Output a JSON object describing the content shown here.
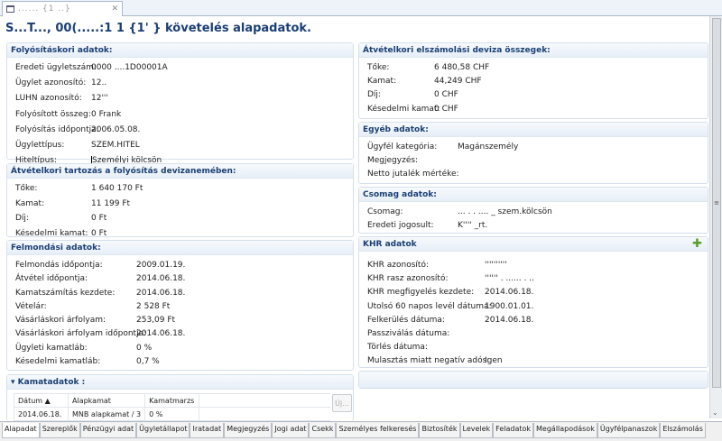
{
  "editor_tab": {
    "label": "......     {1 ..}",
    "close": "✕"
  },
  "title": "S...T..., 00(.....:1   1 {1'   } követelés alapadatok.",
  "folyositas": {
    "header": "Folyósításkori adatok:",
    "rows": [
      {
        "label": "Eredeti ügyletszám:",
        "value": "0000 ....1D00001A"
      },
      {
        "label": "Ügylet azonosító:",
        "value": "12.."
      },
      {
        "label": "LUHN azonosító:",
        "value": "12'''"
      },
      {
        "label": "Folyósított összeg:",
        "value": "0 Frank"
      },
      {
        "label": "Folyósítás időpontja:",
        "value": "2006.05.08."
      },
      {
        "label": "Ügylettípus:",
        "value": "SZEM.HITEL"
      },
      {
        "label": "Hiteltípus:",
        "value": "Személyi kölcsön"
      }
    ]
  },
  "tartozas": {
    "header": "Átvételkori tartozás a folyósítás devizanemében:",
    "rows": [
      {
        "label": "Tőke:",
        "value": "1 640 170 Ft"
      },
      {
        "label": "Kamat:",
        "value": "11 199 Ft"
      },
      {
        "label": "Díj:",
        "value": "0 Ft"
      },
      {
        "label": "Késedelmi kamat:",
        "value": "0 Ft"
      }
    ]
  },
  "felmondas": {
    "header": "Felmondási adatok:",
    "rows": [
      {
        "label": "Felmondás időpontja:",
        "value": "2009.01.19."
      },
      {
        "label": "Átvétel időpontja:",
        "value": " 2014.06.18."
      },
      {
        "label": "Kamatszámítás kezdete:",
        "value": " 2014.06.18."
      },
      {
        "label": "Vételár:",
        "value": "2 528 Ft"
      },
      {
        "label": "Vásárláskori árfolyam:",
        "value": "253,09 Ft"
      },
      {
        "label": "Vásárláskori árfolyam időpontja:",
        "value": "2014.06.18."
      },
      {
        "label": "Ügyleti kamatláb:",
        "value": " 0 %"
      },
      {
        "label": "Késedelmi kamatláb:",
        "value": " 0,7 %"
      }
    ]
  },
  "kamatadatok": {
    "header": "Kamatadatok :",
    "columns": [
      "Dátum",
      "Alapkamat",
      "Kamatmarzs"
    ],
    "rows": [
      [
        "2014.06.18.",
        "MNB alapkamat / 3",
        "0 %"
      ]
    ],
    "new_button": "Új..."
  },
  "deviza": {
    "header": "Átvételkori elszámolási deviza összegek:",
    "rows": [
      {
        "label": "Tőke:",
        "value": "6 480,58 CHF"
      },
      {
        "label": "Kamat:",
        "value": "44,249 CHF"
      },
      {
        "label": "Díj:",
        "value": "0 CHF"
      },
      {
        "label": "Késedelmi kamat:",
        "value": "0 CHF"
      }
    ]
  },
  "egyeb": {
    "header": "Egyéb adatok:",
    "rows": [
      {
        "label": "Ügyfél kategória:",
        "value": "Magánszemély"
      },
      {
        "label": "Megjegyzés:",
        "value": ""
      },
      {
        "label": "Netto jutalék mértéke:",
        "value": ""
      }
    ]
  },
  "csomag": {
    "header": "Csomag adatok:",
    "rows": [
      {
        "label": "Csomag:",
        "value": "... . . .... _ szem.kölcsön"
      },
      {
        "label": "Eredeti jogosult:",
        "value": "K''''     _rt."
      }
    ]
  },
  "khr": {
    "header": "KHR adatok",
    "rows": [
      {
        "label": "KHR azonosító:",
        "value": "''''''''''"
      },
      {
        "label": "KHR rasz azonosító:",
        "value": "''''''  . ...... . .."
      },
      {
        "label": "KHR megfigyelés kezdete:",
        "value": "2014.06.18."
      },
      {
        "label": "Utolsó 60 napos levél dátuma:",
        "value": "1900.01.01."
      },
      {
        "label": "Felkerülés dátuma:",
        "value": "2014.06.18."
      },
      {
        "label": "Passziválás dátuma:",
        "value": ""
      },
      {
        "label": "Törlés dátuma:",
        "value": ""
      },
      {
        "label": "Mulasztás miatt negatív adós:",
        "value": "Igen"
      }
    ]
  },
  "bottom_tabs": [
    "Alapadat",
    "Szereplők",
    "Pénzügyi adat",
    "Ügyletállapot",
    "Iratadat",
    "Megjegyzés",
    "Jogi adat",
    "Csekk",
    "Személyes felkeresés",
    "Biztosíték",
    "Levelek",
    "Feladatok",
    "Megállapodások",
    "Ügyfélpanaszok",
    "Elszámolás"
  ],
  "colors": {
    "header_text": "#1b3f73",
    "plus": "#5a9e2a"
  }
}
